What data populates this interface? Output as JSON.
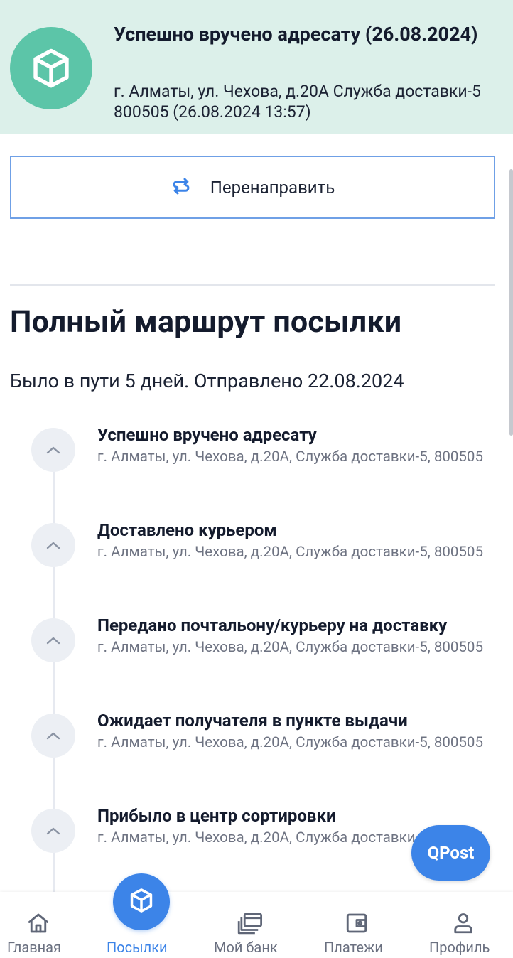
{
  "status": {
    "title": "Успешно вручено адресату (26.08.2024)",
    "address": "г. Алматы, ул. Чехова, д.20А Служба доставки-5 800505 (26.08.2024 13:57)",
    "icon": "parcel-box-icon",
    "color": "#5cc5a8"
  },
  "redirect_button": {
    "label": "Перенаправить",
    "icon": "redirect-arrows-icon"
  },
  "route": {
    "title": "Полный маршрут посылки",
    "subtitle": "Было в пути 5 дней. Отправлено 22.08.2024",
    "events": [
      {
        "title": "Успешно вручено адресату",
        "address": "г. Алматы, ул. Чехова, д.20А, Служба доставки-5, 800505"
      },
      {
        "title": "Доставлено курьером",
        "address": "г. Алматы, ул. Чехова, д.20А, Служба доставки-5, 800505"
      },
      {
        "title": "Передано почтальону/курьеру на доставку",
        "address": "г. Алматы, ул. Чехова, д.20А, Служба доставки-5, 800505"
      },
      {
        "title": "Ожидает получателя в пункте выдачи",
        "address": "г. Алматы, ул. Чехова, д.20А, Служба доставки-5, 800505"
      },
      {
        "title": "Прибыло в центр сортировки",
        "address": "г. Алматы, ул. Чехова, д.20А, Служба доставки-5, 800505"
      }
    ]
  },
  "qpost_button": {
    "label": "QPost"
  },
  "tabbar": {
    "items": [
      {
        "label": "Главная",
        "icon": "home-icon"
      },
      {
        "label": "Посылки",
        "icon": "parcel-box-icon",
        "active": true
      },
      {
        "label": "Мой банк",
        "icon": "bank-cards-icon"
      },
      {
        "label": "Платежи",
        "icon": "wallet-icon"
      },
      {
        "label": "Профиль",
        "icon": "profile-icon"
      }
    ]
  },
  "colors": {
    "accent": "#3c84e8",
    "status_bg": "#dcf0ea",
    "status_icon": "#5cc5a8"
  }
}
